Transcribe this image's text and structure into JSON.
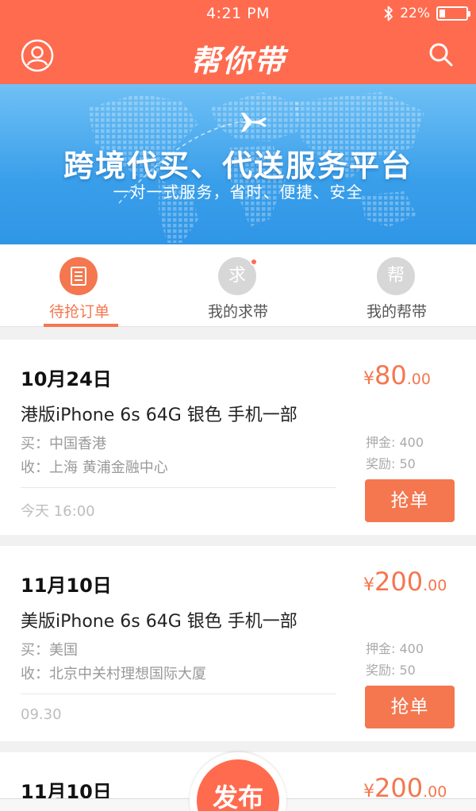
{
  "status_bar": {
    "time": "4:21 PM",
    "battery": "22%",
    "battery_level": 0.22
  },
  "header": {
    "title": "帮你带"
  },
  "banner": {
    "title": "跨境代买、代送服务平台",
    "subtitle": "一对一式服务，省时、便捷、安全"
  },
  "tabs": [
    {
      "icon_char": "",
      "label": "待抢订单",
      "active": true
    },
    {
      "icon_char": "求",
      "label": "我的求带",
      "active": false,
      "has_dot": true
    },
    {
      "icon_char": "帮",
      "label": "我的帮带",
      "active": false
    }
  ],
  "orders": [
    {
      "date": "10月24日",
      "item": "港版iPhone 6s 64G 银色 手机一部",
      "buy": "买：中国香港",
      "receive": "收：上海 黄浦金融中心",
      "time": "今天 16:00",
      "price_symbol": "¥",
      "price_int": "80",
      "price_dec": ".00",
      "deposit": "押金: 400",
      "reward": "奖励: 50",
      "action": "抢单"
    },
    {
      "date": "11月10日",
      "item": "美版iPhone 6s 64G 银色 手机一部",
      "buy": "买：美国",
      "receive": "收：北京中关村理想国际大厦",
      "time": "09.30",
      "price_symbol": "¥",
      "price_int": "200",
      "price_dec": ".00",
      "deposit": "押金: 400",
      "reward": "奖励: 50",
      "action": "抢单"
    },
    {
      "date": "11月10日",
      "price_symbol": "¥",
      "price_int": "200",
      "price_dec": ".00"
    }
  ],
  "publish": {
    "label": "发布"
  },
  "colors": {
    "brand": "#ff6b4f",
    "accent": "#f4774f",
    "banner": "#3a9fea"
  }
}
